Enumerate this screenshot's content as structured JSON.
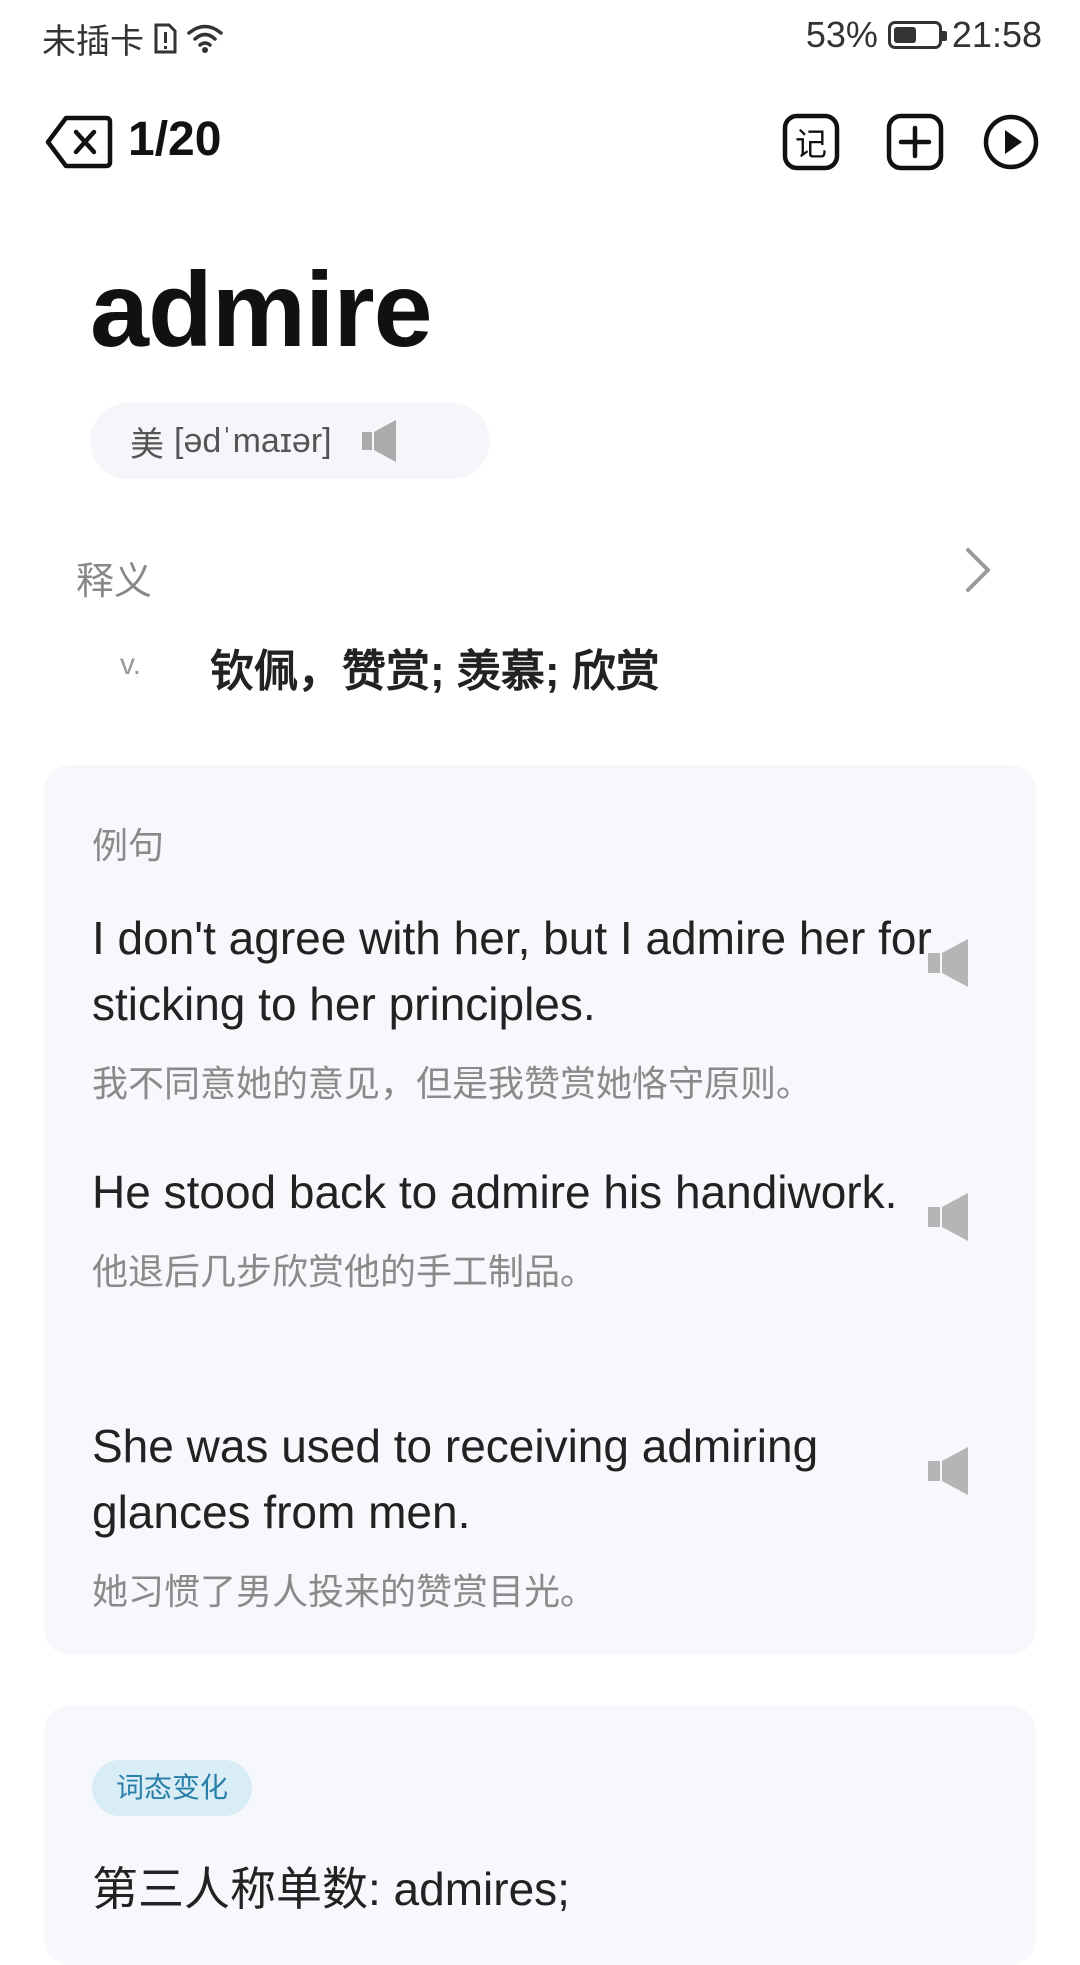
{
  "status": {
    "carrier": "未插卡",
    "battery_percent": "53%",
    "battery_level": 0.53,
    "time": "21:58"
  },
  "topbar": {
    "counter": "1/20",
    "buttons": [
      "close-icon",
      "memorize-icon",
      "add-icon",
      "play-icon"
    ],
    "memorize_glyph": "记"
  },
  "word": {
    "text": "admire",
    "pron_region": "美",
    "phonetic": "[ədˈmaɪər]"
  },
  "definitions": {
    "label": "释义",
    "items": [
      {
        "pos": "v.",
        "meaning": "钦佩，赞赏; 羡慕; 欣赏"
      }
    ]
  },
  "examples": {
    "title": "例句",
    "items": [
      {
        "en": "I don't agree with her, but I admire her for sticking to her principles.",
        "zh": "我不同意她的意见，但是我赞赏她恪守原则。"
      },
      {
        "en": "He stood back to admire his handiwork.",
        "zh": "他退后几步欣赏他的手工制品。"
      },
      {
        "en": "She was used to receiving admiring glances from men.",
        "zh": "她习惯了男人投来的赞赏目光。"
      }
    ]
  },
  "inflections": {
    "tag": "词态变化",
    "line": "第三人称单数: admires;"
  },
  "colors": {
    "card_bg": "#f6f8fb",
    "tag_bg": "#d9edf7",
    "tag_text": "#2a7fa8",
    "muted": "#8a8a8a"
  }
}
